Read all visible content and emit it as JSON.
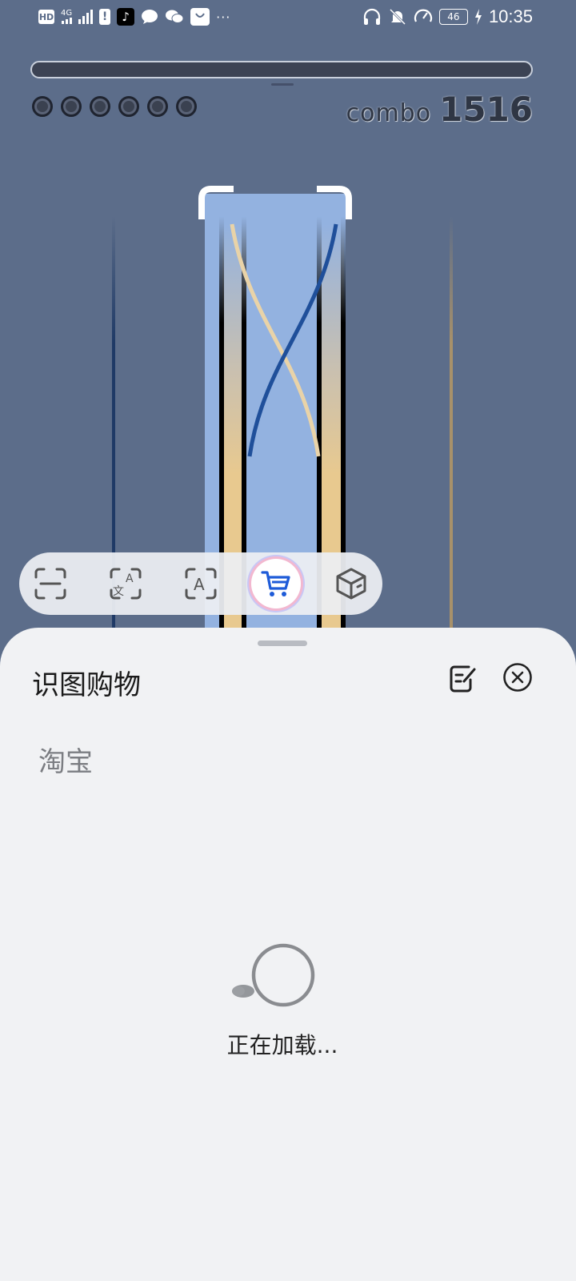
{
  "status_bar": {
    "left_icons": [
      "hd-icon",
      "network-4g-icon",
      "signal-icon",
      "alert-icon",
      "tiktok-icon",
      "message-icon",
      "wechat-icon",
      "taobao-bag-icon",
      "more-dots-icon"
    ],
    "hd_label": "HD",
    "network_label": "4G",
    "more_label": "···",
    "battery_level": "46",
    "time": "10:35",
    "right_icons": [
      "headphones-icon",
      "bell-muted-icon",
      "speed-icon",
      "battery-icon",
      "charging-icon"
    ]
  },
  "game": {
    "combo_label": "combo",
    "combo_value": "1516",
    "lives_count": 6,
    "progress_fraction": 1.0,
    "colors": {
      "background": "#5c6d8a",
      "note_blue": "#93b2e0",
      "note_cream": "#e8c98f",
      "dark_rail": "#1f3a66",
      "gold_rail": "#a8916a"
    }
  },
  "lens_toolbar": {
    "tools": [
      {
        "icon": "scan-icon",
        "active": false
      },
      {
        "icon": "translate-icon",
        "active": false
      },
      {
        "icon": "text-recognition-icon",
        "active": false
      },
      {
        "icon": "shopping-cart-icon",
        "active": true
      },
      {
        "icon": "3d-cube-icon",
        "active": false
      }
    ],
    "accent_color": "#1e5bd8"
  },
  "sheet": {
    "title": "识图购物",
    "source": "淘宝",
    "loading_text": "正在加载...",
    "edit_icon": "edit-note-icon",
    "close_icon": "close-circle-icon"
  }
}
